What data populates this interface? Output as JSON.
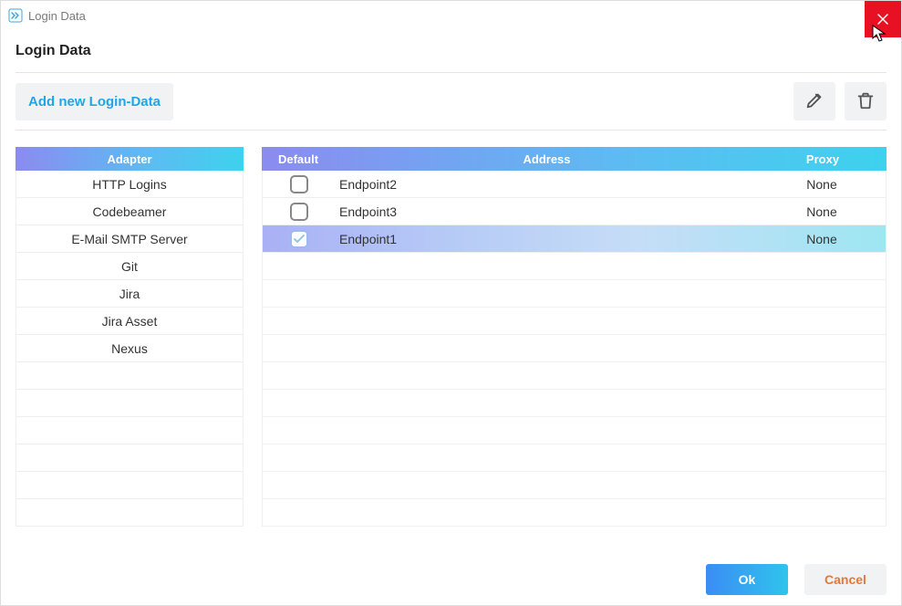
{
  "window": {
    "title": "Login Data"
  },
  "heading": "Login Data",
  "toolbar": {
    "add_label": "Add new Login-Data"
  },
  "adapters": {
    "header": "Adapter",
    "items": [
      {
        "label": "HTTP Logins"
      },
      {
        "label": "Codebeamer"
      },
      {
        "label": "E-Mail SMTP Server"
      },
      {
        "label": "Git"
      },
      {
        "label": "Jira"
      },
      {
        "label": "Jira Asset"
      },
      {
        "label": "Nexus"
      }
    ]
  },
  "entries": {
    "headers": {
      "default": "Default",
      "address": "Address",
      "proxy": "Proxy"
    },
    "rows": [
      {
        "default": false,
        "address": "Endpoint2",
        "proxy": "None",
        "selected": false
      },
      {
        "default": false,
        "address": "Endpoint3",
        "proxy": "None",
        "selected": false
      },
      {
        "default": true,
        "address": "Endpoint1",
        "proxy": "None",
        "selected": true
      }
    ]
  },
  "footer": {
    "ok": "Ok",
    "cancel": "Cancel"
  }
}
